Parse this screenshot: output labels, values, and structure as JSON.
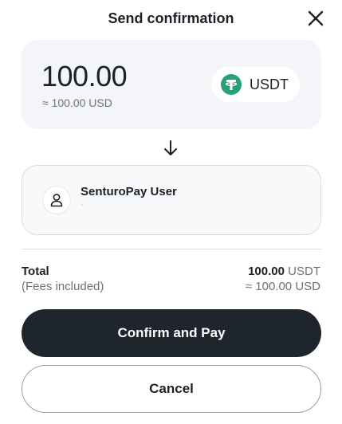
{
  "header": {
    "title": "Send confirmation",
    "close_icon": "close-icon"
  },
  "amount": {
    "value": "100.00",
    "fiat": "≈ 100.00 USD",
    "currency": "USDT",
    "currency_icon": "tether-icon",
    "currency_color": "#26a17b"
  },
  "transfer_arrow_icon": "arrow-down-icon",
  "recipient": {
    "name": "SenturoPay User",
    "subtitle": "-",
    "avatar_icon": "user-icon"
  },
  "summary": {
    "total_label": "Total",
    "fees_label": "(Fees included)",
    "total_value": "100.00",
    "total_unit": "USDT",
    "total_fiat": "≈ 100.00 USD"
  },
  "actions": {
    "confirm_label": "Confirm and Pay",
    "cancel_label": "Cancel"
  },
  "colors": {
    "primary_button": "#1f252d",
    "card_background": "#f3f5f8"
  }
}
